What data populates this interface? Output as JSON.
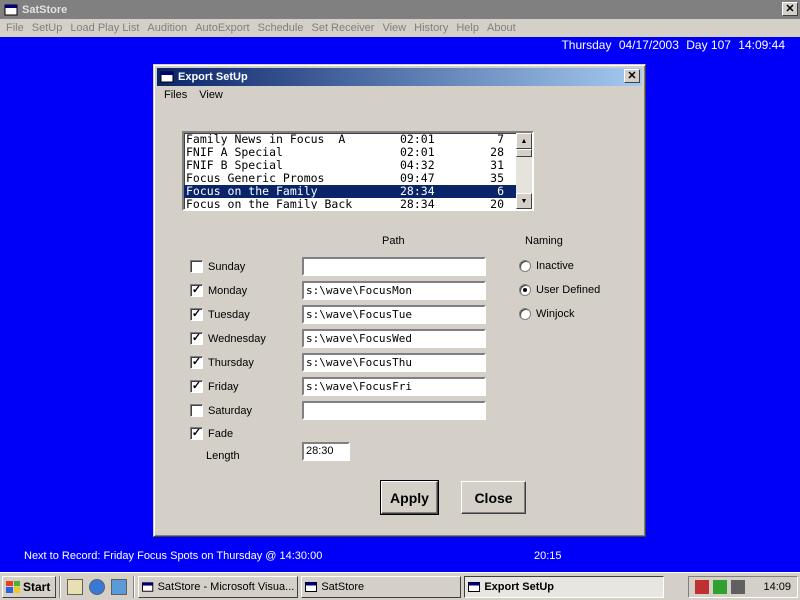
{
  "app": {
    "title": "SatStore",
    "close_label": "✕"
  },
  "menu": [
    "File",
    "SetUp",
    "Load Play List",
    "Audition",
    "AutoExport",
    "Schedule",
    "Set Receiver",
    "View",
    "History",
    "Help",
    "About"
  ],
  "clock": {
    "weekday": "Thursday",
    "date": "04/17/2003",
    "day": "Day 107",
    "time": "14:09:44"
  },
  "dialog": {
    "title": "Export SetUp",
    "close_label": "✕",
    "menu": [
      "Files",
      "View"
    ],
    "list": [
      {
        "name": "Family News in Focus  A",
        "length": "02:01",
        "count": "7"
      },
      {
        "name": "FNIF A Special",
        "length": "02:01",
        "count": "28"
      },
      {
        "name": "FNIF B Special",
        "length": "04:32",
        "count": "31"
      },
      {
        "name": "Focus Generic Promos",
        "length": "09:47",
        "count": "35"
      },
      {
        "name": "Focus on the Family",
        "length": "28:34",
        "count": "6",
        "selected": true
      },
      {
        "name": "Focus on the Family Back",
        "length": "28:34",
        "count": "20"
      }
    ],
    "path_header": "Path",
    "naming_header": "Naming",
    "days": [
      {
        "label": "Sunday",
        "checked": false,
        "path": ""
      },
      {
        "label": "Monday",
        "checked": true,
        "path": "s:\\wave\\FocusMon"
      },
      {
        "label": "Tuesday",
        "checked": true,
        "path": "s:\\wave\\FocusTue"
      },
      {
        "label": "Wednesday",
        "checked": true,
        "path": "s:\\wave\\FocusWed"
      },
      {
        "label": "Thursday",
        "checked": true,
        "path": "s:\\wave\\FocusThu"
      },
      {
        "label": "Friday",
        "checked": true,
        "path": "s:\\wave\\FocusFri"
      },
      {
        "label": "Saturday",
        "checked": false,
        "path": ""
      }
    ],
    "fade": {
      "label": "Fade",
      "checked": true
    },
    "length": {
      "label": "Length",
      "value": "28:30"
    },
    "naming_options": [
      {
        "label": "Inactive",
        "selected": false
      },
      {
        "label": "User Defined",
        "selected": true
      },
      {
        "label": "Winjock",
        "selected": false
      }
    ],
    "apply_label": "Apply",
    "close_button_label": "Close"
  },
  "status": {
    "next_record": "Next to Record:  Friday  Focus Spots on  Thursday  @ 14:30:00",
    "time": "20:15"
  },
  "taskbar": {
    "start_label": "Start",
    "tasks": [
      {
        "label": "SatStore - Microsoft Visua...",
        "active": false
      },
      {
        "label": "SatStore",
        "active": false
      },
      {
        "label": "Export SetUp",
        "active": true
      }
    ],
    "clock": "14:09"
  },
  "colors": {
    "desktop": "#0000f8",
    "title_active": "#0a246a",
    "title_inactive": "#808080",
    "face": "#d4d0c8"
  }
}
